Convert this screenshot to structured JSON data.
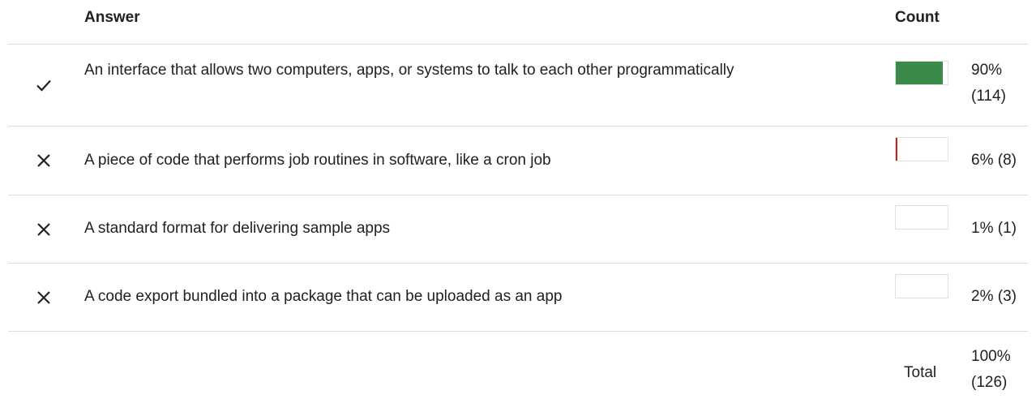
{
  "header": {
    "answer": "Answer",
    "count": "Count"
  },
  "colors": {
    "correct_fill": "#3b8a4a",
    "incorrect_fill": "#c5221f"
  },
  "rows": [
    {
      "answer": "An interface that allows two computers, apps, or systems to talk to each other programmatically",
      "mark": "check-icon",
      "correct": true,
      "fraction": 0.9,
      "percent_line1": "90%",
      "percent_line2": "(114)"
    },
    {
      "answer": "A piece of code that performs job routines in software, like a cron job",
      "mark": "cross-icon",
      "correct": false,
      "fraction": 0.06,
      "percent": "6% (8)"
    },
    {
      "answer": "A standard format for delivering sample apps",
      "mark": "cross-icon",
      "correct": false,
      "fraction": 0.01,
      "percent": "1% (1)"
    },
    {
      "answer": "A code export bundled into a package that can be uploaded as an app",
      "mark": "cross-icon",
      "correct": false,
      "fraction": 0.02,
      "percent": "2% (3)"
    }
  ],
  "total": {
    "label": "Total",
    "line1": "100%",
    "line2": "(126)"
  }
}
